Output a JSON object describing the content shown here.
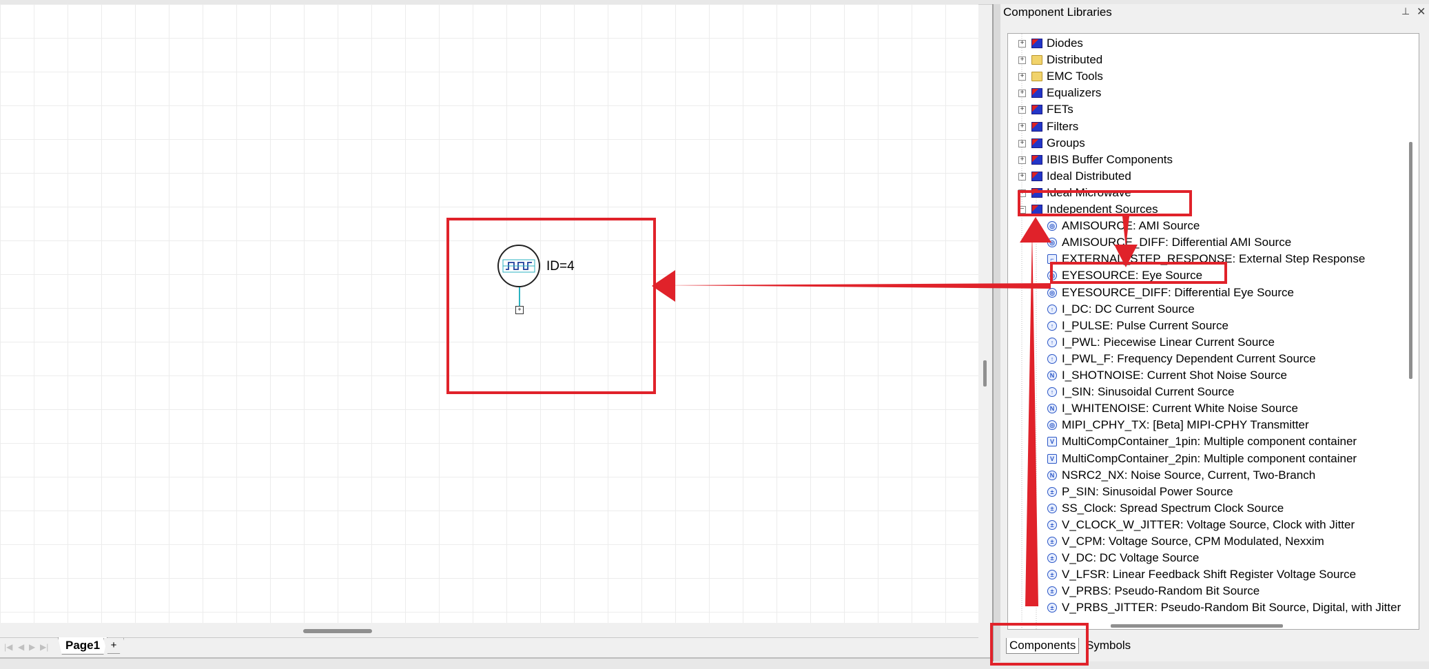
{
  "panel": {
    "title": "Component Libraries",
    "tabs": [
      {
        "label": "Components"
      },
      {
        "label": "Symbols"
      }
    ],
    "libraries": [
      {
        "label": "Diodes",
        "icon": "cube"
      },
      {
        "label": "Distributed",
        "icon": "folder"
      },
      {
        "label": "EMC Tools",
        "icon": "folder"
      },
      {
        "label": "Equalizers",
        "icon": "cube"
      },
      {
        "label": "FETs",
        "icon": "cube"
      },
      {
        "label": "Filters",
        "icon": "cube"
      },
      {
        "label": "Groups",
        "icon": "cube"
      },
      {
        "label": "IBIS Buffer Components",
        "icon": "cube"
      },
      {
        "label": "Ideal Distributed",
        "icon": "cube"
      },
      {
        "label": "Ideal Microwave",
        "icon": "cube"
      },
      {
        "label": "Independent Sources",
        "icon": "cube",
        "expanded": true
      }
    ],
    "items": [
      {
        "label": "AMISOURCE: AMI Source",
        "icon": "source-icon"
      },
      {
        "label": "AMISOURCE_DIFF: Differential AMI Source",
        "icon": "source-icon"
      },
      {
        "label": "EXTERNAL_STEP_RESPONSE: External Step Response",
        "icon": "step-icon"
      },
      {
        "label": "EYESOURCE: Eye Source",
        "icon": "source-icon"
      },
      {
        "label": "EYESOURCE_DIFF: Differential Eye Source",
        "icon": "source-icon"
      },
      {
        "label": "I_DC: DC Current Source",
        "icon": "current-icon"
      },
      {
        "label": "I_PULSE: Pulse Current Source",
        "icon": "current-icon"
      },
      {
        "label": "I_PWL: Piecewise Linear Current Source",
        "icon": "current-icon"
      },
      {
        "label": "I_PWL_F: Frequency Dependent Current Source",
        "icon": "current-icon"
      },
      {
        "label": "I_SHOTNOISE: Current Shot Noise Source",
        "icon": "noise-icon"
      },
      {
        "label": "I_SIN: Sinusoidal Current Source",
        "icon": "current-icon"
      },
      {
        "label": "I_WHITENOISE: Current White Noise Source",
        "icon": "noise-icon"
      },
      {
        "label": "MIPI_CPHY_TX: [Beta] MIPI-CPHY Transmitter",
        "icon": "source-icon"
      },
      {
        "label": "MultiCompContainer_1pin: Multiple component container",
        "icon": "container-icon"
      },
      {
        "label": "MultiCompContainer_2pin: Multiple component container",
        "icon": "container-icon"
      },
      {
        "label": "NSRC2_NX: Noise Source, Current, Two-Branch",
        "icon": "noise-icon"
      },
      {
        "label": "P_SIN: Sinusoidal Power Source",
        "icon": "voltage-icon"
      },
      {
        "label": "SS_Clock: Spread Spectrum Clock Source",
        "icon": "voltage-icon"
      },
      {
        "label": "V_CLOCK_W_JITTER: Voltage Source, Clock with Jitter",
        "icon": "voltage-icon"
      },
      {
        "label": "V_CPM: Voltage Source, CPM Modulated, Nexxim",
        "icon": "voltage-icon"
      },
      {
        "label": "V_DC: DC Voltage Source",
        "icon": "voltage-icon"
      },
      {
        "label": "V_LFSR: Linear Feedback Shift Register Voltage Source",
        "icon": "voltage-icon"
      },
      {
        "label": "V_PRBS: Pseudo-Random Bit Source",
        "icon": "voltage-icon"
      },
      {
        "label": "V_PRBS_JITTER: Pseudo-Random Bit Source, Digital, with Jitter",
        "icon": "voltage-icon"
      }
    ]
  },
  "canvas": {
    "component_id": "ID=4",
    "page_tab": "Page1",
    "add_tab": "+"
  },
  "colors": {
    "annotation": "#e0222a",
    "wire": "#2bb3c0"
  }
}
